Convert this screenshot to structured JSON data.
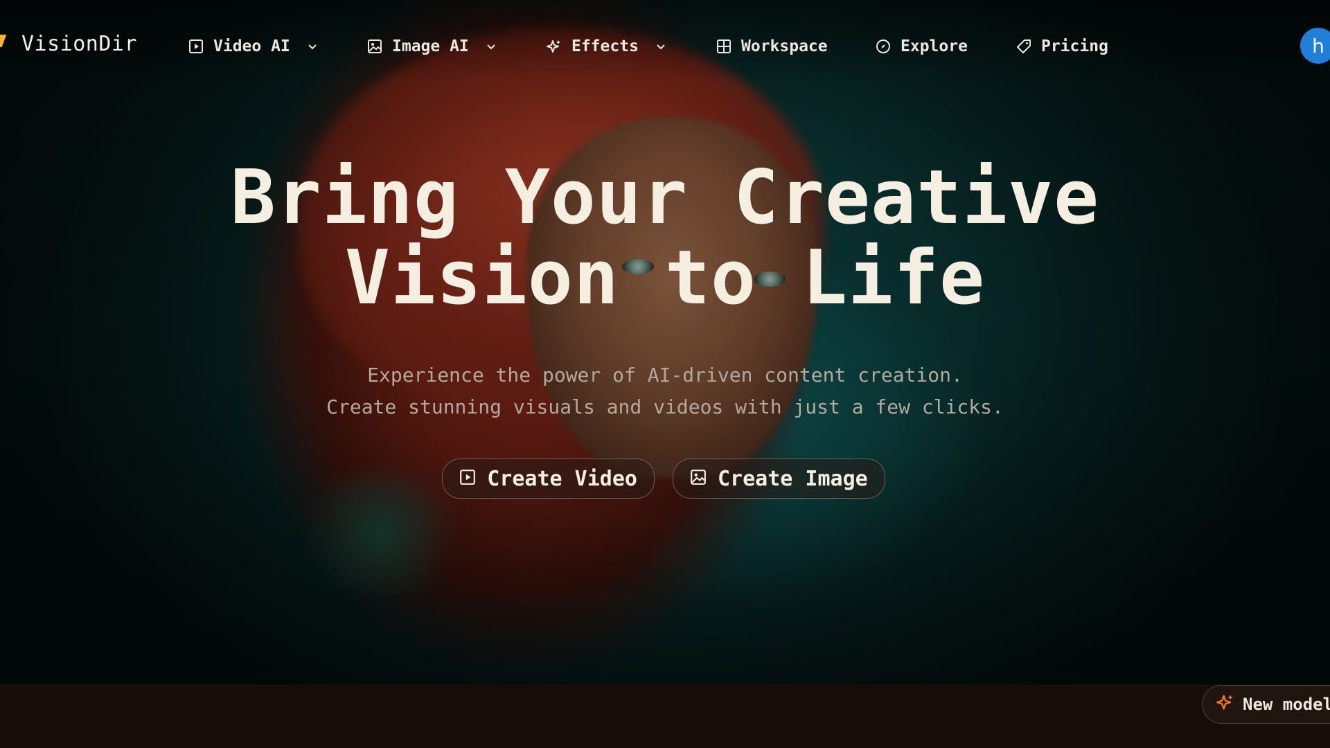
{
  "brand": {
    "name": "VisionDir",
    "accent": "#f0b43a"
  },
  "nav": {
    "items": [
      {
        "label": "Video AI",
        "icon": "play-square-icon",
        "has_dropdown": true
      },
      {
        "label": "Image AI",
        "icon": "image-icon",
        "has_dropdown": true
      },
      {
        "label": "Effects",
        "icon": "sparkles-icon",
        "has_dropdown": true
      },
      {
        "label": "Workspace",
        "icon": "grid-icon",
        "has_dropdown": false
      },
      {
        "label": "Explore",
        "icon": "compass-icon",
        "has_dropdown": false
      },
      {
        "label": "Pricing",
        "icon": "tag-icon",
        "has_dropdown": false
      }
    ],
    "avatar_initial": "h",
    "avatar_color": "#1f7fd9"
  },
  "hero": {
    "headline_line1": "Bring Your Creative",
    "headline_line2": "Vision to Life",
    "subtitle_line1": "Experience the power of AI-driven content creation.",
    "subtitle_line2": "Create stunning visuals and videos with just a few clicks.",
    "cta_video": "Create Video",
    "cta_image": "Create Image"
  },
  "badge": {
    "label": "New model",
    "icon": "sparkles-icon",
    "icon_color": "#f07a2a"
  }
}
